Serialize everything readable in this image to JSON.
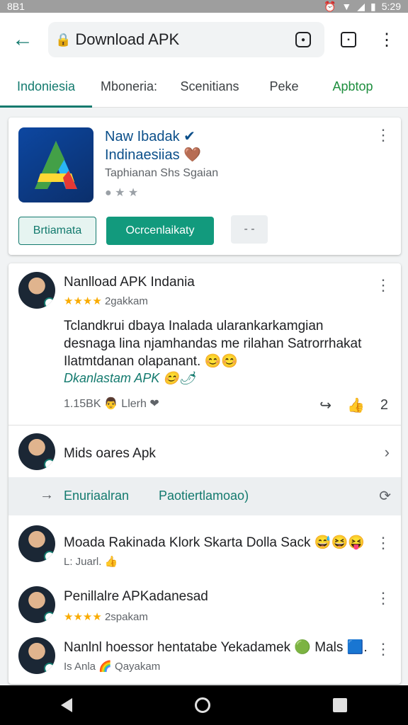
{
  "status_bar": {
    "left": "8B1",
    "time": "5:29"
  },
  "header": {
    "url_text": "Download APK"
  },
  "tabs": [
    {
      "label": "Indoniesia"
    },
    {
      "label": "Mboneria:"
    },
    {
      "label": "Scenitians"
    },
    {
      "label": "Peke"
    },
    {
      "label": "Apbtop"
    }
  ],
  "app_card": {
    "title_line1": "Naw Ibadak ✔",
    "title_line2": "Indinaesiias 🤎",
    "developer": "Taphianan  Shs Sgaian",
    "rating": "● ★ ★",
    "btn_outline": "Brtiamata",
    "btn_primary": "Ocrcenlaikaty",
    "btn_grey": "- -"
  },
  "post1": {
    "name": "Nanlload APK Indania",
    "stars": "★★★★",
    "sub": "2gakkam",
    "body": "Tclandkrui dbaya Inalada ularankarkamgian desnaga lina njamhandas me rilahan Satrorrhakat Ilatmtdanan olapanant. 😊😊",
    "link": "Dkanlastam APK 😊🌶",
    "meta": "1.15BK  👨 Llerh ❤",
    "share_count": "2"
  },
  "row2": {
    "name": "Mids oares Apk"
  },
  "band": {
    "link1": "Enuriaalran",
    "link2": "Paotiertlamoao)"
  },
  "post3": {
    "name": "Moada Rakinada Klork Skarta Dolla Sack 😅😆😝",
    "sub": "L: Juarl. 👍"
  },
  "post4": {
    "name": "Penillalre APKadanesad",
    "stars": "★★★★",
    "sub": "2spakam"
  },
  "post5": {
    "name": "Nanlnl hoessor hentatabe Yekadamek 🟢 Mals 🟦.",
    "sub": "Is Anla 🌈 Qayakam"
  },
  "colors": {
    "accent": "#137a6e",
    "primary_button": "#129a7d"
  }
}
